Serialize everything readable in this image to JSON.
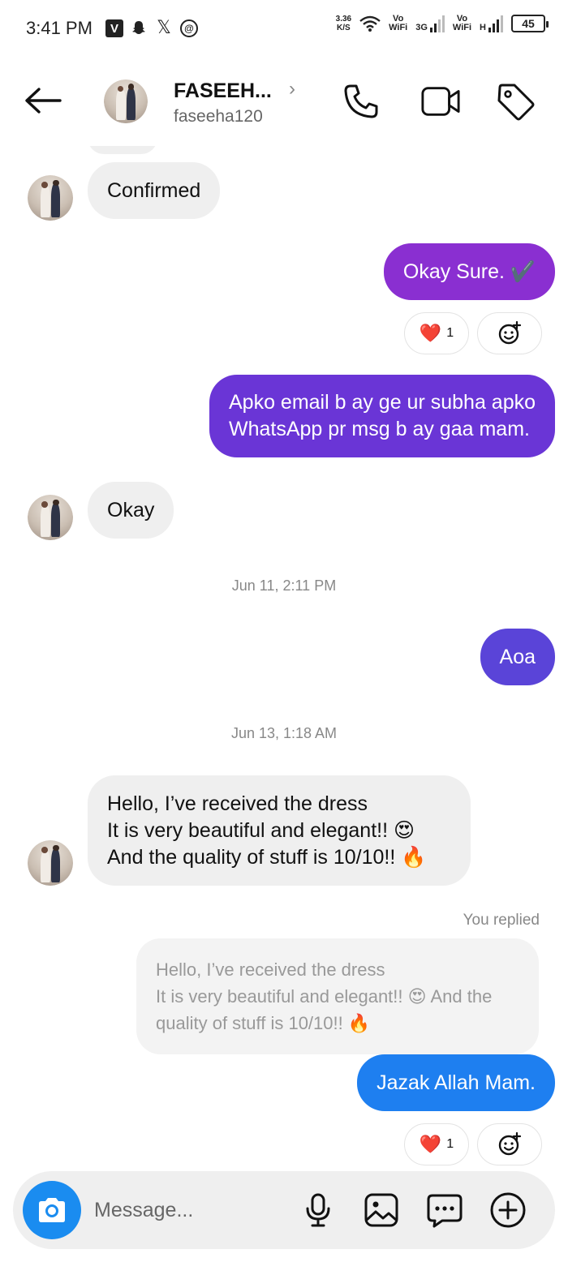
{
  "status_bar": {
    "time": "3:41 PM",
    "app_icons": [
      "v-app-icon",
      "snapchat-icon",
      "x-icon",
      "threads-icon"
    ],
    "v_label": "V",
    "x_label": "𝕏",
    "threads_label": "@",
    "speed": "3.36",
    "speed_unit": "K/S",
    "vowifi_1": "Vo\nWiFi",
    "net_1": "3G",
    "vowifi_2": "Vo\nWiFi",
    "net_2": "H",
    "battery": "45"
  },
  "header": {
    "name": "FASEEH...",
    "username": "faseeha120",
    "chevron": "›"
  },
  "messages": {
    "confirmed": "Confirmed",
    "okay_sure": "Okay Sure. ✔️",
    "reaction_1_count": "1",
    "apko_line1": "Apko email b ay ge ur subha apko",
    "apko_line2": "WhatsApp pr msg b ay gaa mam.",
    "okay": "Okay",
    "timestamp_1": "Jun 11, 2:11 PM",
    "aoa": "Aoa",
    "timestamp_2": "Jun 13, 1:18 AM",
    "hello_line1": "Hello, I’ve received the dress",
    "hello_line2": "It is very beautiful and elegant!! 😍",
    "hello_line3": "And the quality of stuff is 10/10!! 🔥",
    "you_replied": "You replied",
    "quoted_line1": "Hello, I’ve received the dress",
    "quoted_line2": "It is very beautiful and elegant!! 😍 And the",
    "quoted_line3": "quality of stuff is 10/10!! 🔥",
    "jazak": "Jazak Allah Mam.",
    "reaction_2_count": "1"
  },
  "composer": {
    "placeholder": "Message..."
  },
  "colors": {
    "purple": "#8a2fd1",
    "violet": "#6a35d6",
    "indigo": "#5a44d8",
    "blue": "#1e7ff0",
    "incoming": "#efefef",
    "camera": "#1a8cf0"
  },
  "icons": [
    "back-arrow-icon",
    "phone-icon",
    "video-icon",
    "tag-icon",
    "heart-icon",
    "add-reaction-icon",
    "camera-icon",
    "mic-icon",
    "gallery-icon",
    "sticker-icon",
    "plus-icon"
  ]
}
